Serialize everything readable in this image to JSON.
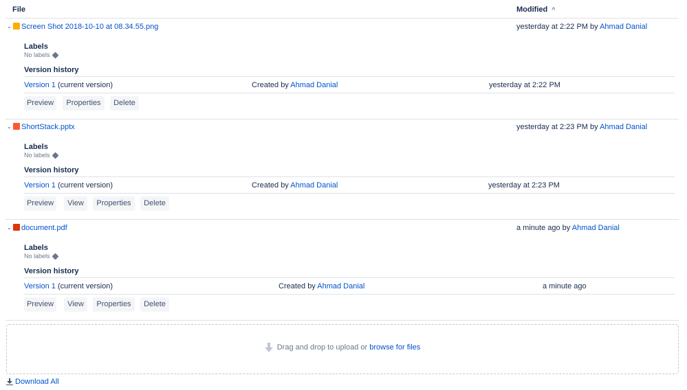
{
  "header": {
    "file_label": "File",
    "modified_label": "Modified",
    "sort_indicator": "^"
  },
  "labels_title": "Labels",
  "no_labels": "No labels",
  "version_history_title": "Version history",
  "files": [
    {
      "name": "Screen Shot 2018-10-10 at 08.34.55.png",
      "icon": "image-file-icon",
      "icon_color": "#ffab00",
      "modified_prefix": "yesterday at 2:22 PM by",
      "modified_user": "Ahmad Danial",
      "version_link": "Version 1",
      "version_suffix": "(current version)",
      "created_prefix": "Created by",
      "created_user": "Ahmad Danial",
      "version_date": "yesterday at 2:22 PM",
      "actions": [
        "Preview",
        "Properties",
        "Delete"
      ]
    },
    {
      "name": "ShortStack.pptx",
      "icon": "presentation-file-icon",
      "icon_color": "#ff5630",
      "modified_prefix": "yesterday at 2:23 PM by",
      "modified_user": "Ahmad Danial",
      "version_link": "Version 1",
      "version_suffix": "(current version)",
      "created_prefix": "Created by",
      "created_user": "Ahmad Danial",
      "version_date": "yesterday at 2:23 PM",
      "actions": [
        "Preview",
        "View",
        "Properties",
        "Delete"
      ]
    },
    {
      "name": "document.pdf",
      "icon": "pdf-file-icon",
      "icon_color": "#de350b",
      "modified_prefix": "a minute ago by",
      "modified_user": "Ahmad Danial",
      "version_link": "Version 1",
      "version_suffix": "(current version)",
      "created_prefix": "Created by",
      "created_user": "Ahmad Danial",
      "version_date": "a minute ago",
      "actions": [
        "Preview",
        "View",
        "Properties",
        "Delete"
      ]
    }
  ],
  "dropzone": {
    "text": "Drag and drop to upload or",
    "link": "browse for files"
  },
  "download_all": "Download All"
}
